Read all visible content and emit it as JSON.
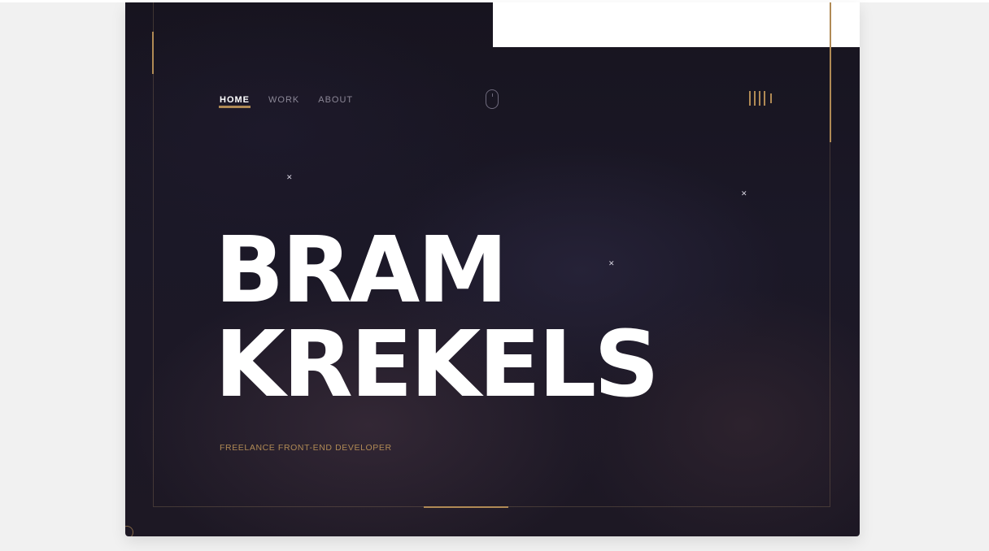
{
  "nav": {
    "items": [
      {
        "label": "HOME",
        "active": true
      },
      {
        "label": "WORK",
        "active": false
      },
      {
        "label": "ABOUT",
        "active": false
      }
    ]
  },
  "hero": {
    "first_name": "BRAM",
    "last_name": "KREKELS",
    "tagline": "FREELANCE FRONT-END DEVELOPER"
  },
  "icons": {
    "scroll": "mouse-scroll-icon",
    "menu": "menu-bars-icon",
    "decor": "star-sparkle-icon"
  },
  "colors": {
    "accent": "#b08a55",
    "background": "#1b1827",
    "page": "#f1f1f1",
    "text": "#ffffff",
    "nav_inactive": "#8b8796"
  }
}
